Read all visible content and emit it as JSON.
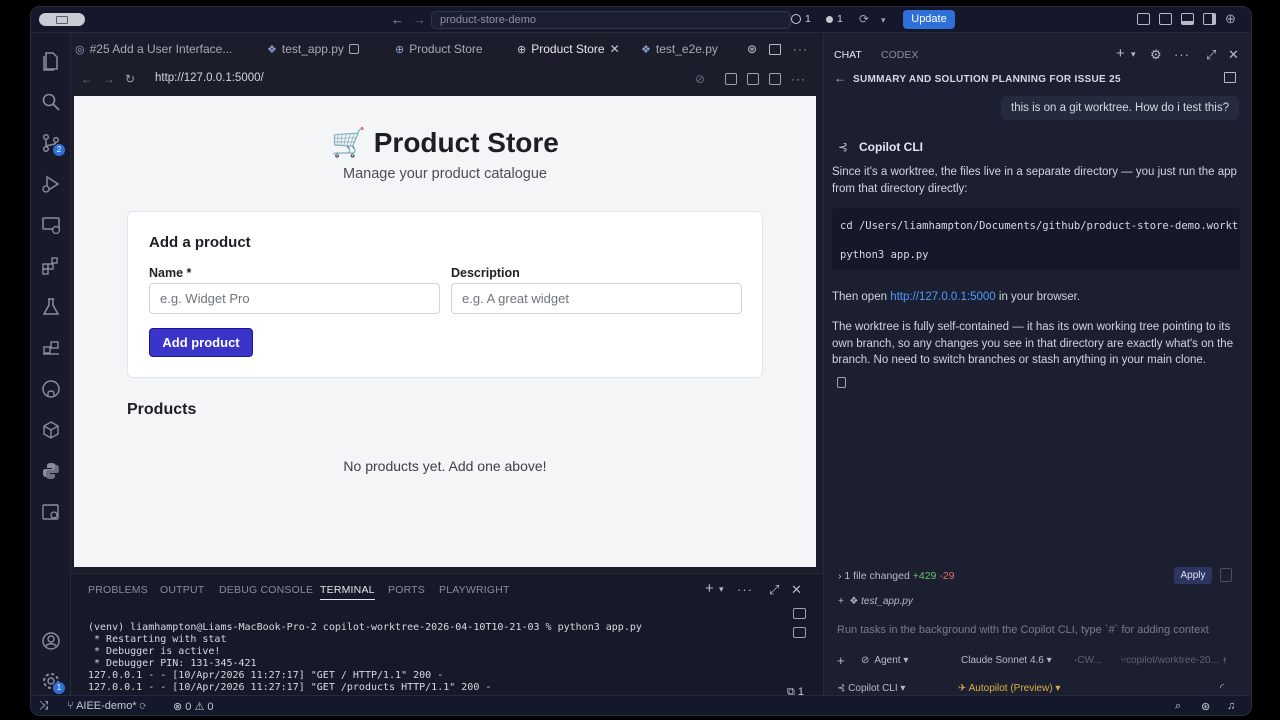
{
  "titlebar": {
    "search": "product-store-demo",
    "stat_changes": "1",
    "stat_problems": "1",
    "update_label": "Update"
  },
  "activity": {
    "source_control_badge": "2",
    "accounts_badge": "1"
  },
  "editor_tabs": [
    {
      "label": "#25 Add a User Interface...",
      "icon": "issue-icon"
    },
    {
      "label": "test_app.py",
      "icon": "python-icon"
    },
    {
      "label": "Product Store",
      "icon": "globe-icon"
    },
    {
      "label": "Product Store",
      "icon": "globe-icon",
      "active": true
    },
    {
      "label": "test_e2e.py",
      "icon": "python-icon"
    }
  ],
  "browser": {
    "url": "http://127.0.0.1:5000/"
  },
  "webpage": {
    "title_emoji": "🛒",
    "title": "Product Store",
    "subtitle": "Manage your product catalogue",
    "card_title": "Add a product",
    "name_label": "Name *",
    "name_placeholder": "e.g. Widget Pro",
    "description_label": "Description",
    "description_placeholder": "e.g. A great widget",
    "add_button": "Add product",
    "products_heading": "Products",
    "empty_message": "No products yet. Add one above!",
    "colors": {
      "button": "#3a34c8",
      "page_bg": "#f4f5f7"
    }
  },
  "panel": {
    "tabs": [
      "PROBLEMS",
      "OUTPUT",
      "DEBUG CONSOLE",
      "TERMINAL",
      "PORTS",
      "PLAYWRIGHT"
    ],
    "active_tab": "TERMINAL",
    "terminal_lines": [
      "(venv) liamhampton@Liams-MacBook-Pro-2 copilot-worktree-2026-04-10T10-21-03 % python3 app.py",
      " * Restarting with stat",
      " * Debugger is active!",
      " * Debugger PIN: 131-345-421",
      "127.0.0.1 - - [10/Apr/2026 11:27:17] \"GET / HTTP/1.1\" 200 -",
      "127.0.0.1 - - [10/Apr/2026 11:27:17] \"GET /products HTTP/1.1\" 200 -"
    ],
    "side_count": "1"
  },
  "statusbar": {
    "branch": "AIEE-demo*",
    "errors": "0",
    "warnings": "0"
  },
  "chat": {
    "tabs": [
      "CHAT",
      "CODEX"
    ],
    "session_title": "SUMMARY AND SOLUTION PLANNING FOR ISSUE 25",
    "user_message": "this is on a git worktree. How do i test this?",
    "agent_name": "Copilot CLI",
    "p1": "Since it's a worktree, the files live in a separate directory — you just run the app from that directory directly:",
    "code_line1": "cd /Users/liamhampton/Documents/github/product-store-demo.worktr",
    "code_line2": "python3 app.py",
    "p2_prefix": "Then open ",
    "p2_link": "http://127.0.0.1:5000",
    "p2_suffix": " in your browser.",
    "p3": "The worktree is fully self-contained — it has its own working tree pointing to its own branch, so any changes you see in that directory are exactly what's on the branch. No need to switch branches or stash anything in your main clone.",
    "changes_label": "1 file changed",
    "changes_add": "+429",
    "changes_del": "-29",
    "apply_label": "Apply",
    "file": "test_app.py",
    "input_placeholder": "Run tasks in the background with the Copilot CLI, type `#` for adding context",
    "mode": "Agent",
    "model": "Claude Sonnet 4.6",
    "workspace": "-CW...",
    "branch": "copilot/worktree-20...",
    "agent_picker": "Copilot CLI",
    "autopilot": "Autopilot (Preview)"
  }
}
